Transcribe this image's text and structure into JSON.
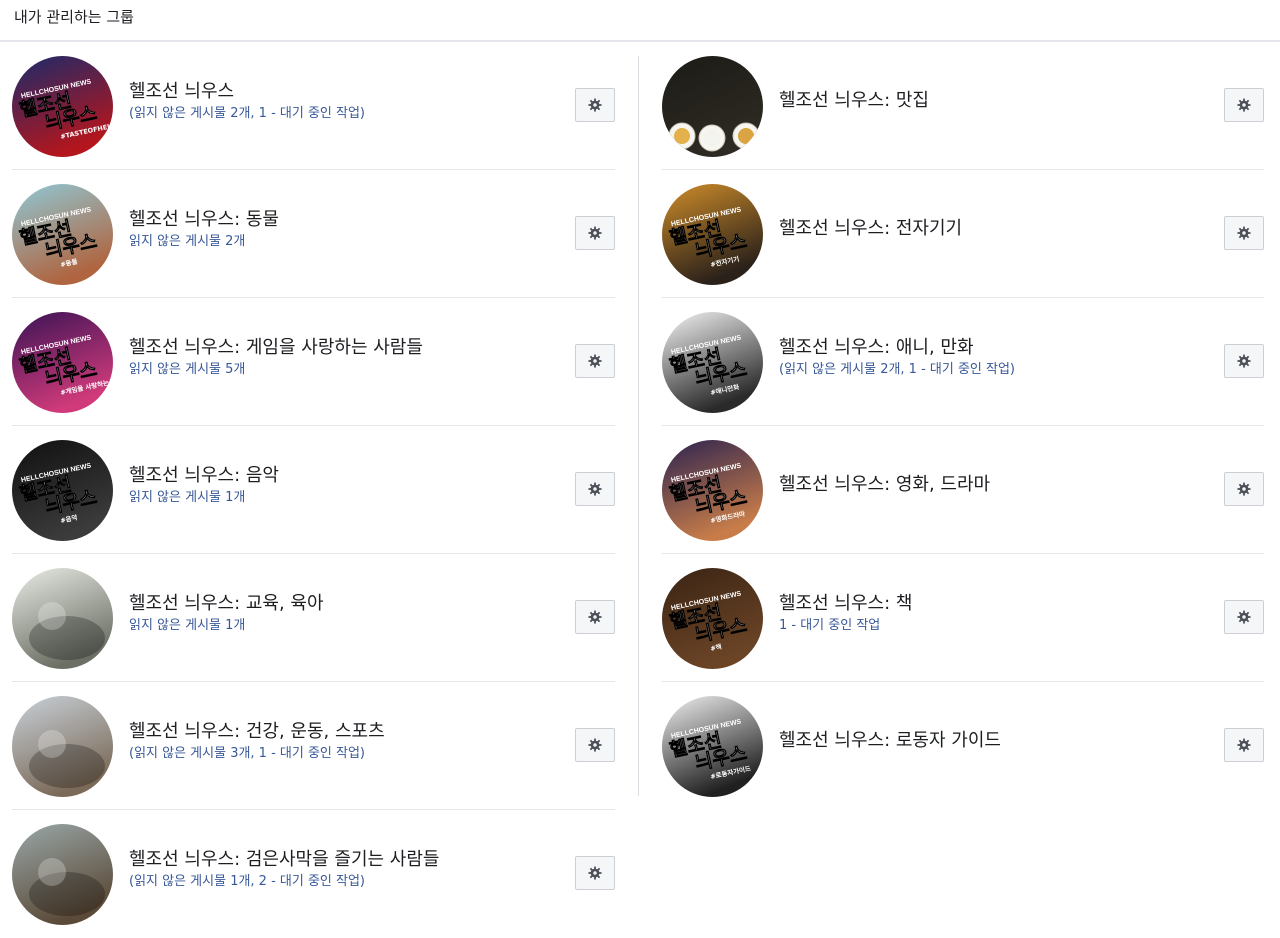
{
  "header": {
    "title": "내가 관리하는 그룹"
  },
  "left": [
    {
      "name": "헬조선 늬우스",
      "status": "(읽지 않은 게시물 2개, 1 - 대기 중인 작업)",
      "avatar": "avatar-tasteofhell"
    },
    {
      "name": "헬조선 늬우스: 동물",
      "status": "읽지 않은 게시물 2개",
      "avatar": "avatar-animals"
    },
    {
      "name": "헬조선 늬우스: 게임을 사랑하는 사람들",
      "status": "읽지 않은 게시물 5개",
      "avatar": "avatar-games"
    },
    {
      "name": "헬조선 늬우스: 음악",
      "status": "읽지 않은 게시물 1개",
      "avatar": "avatar-music"
    },
    {
      "name": "헬조선 늬우스: 교육, 육아",
      "status": "읽지 않은 게시물 1개",
      "avatar": "avatar-education"
    },
    {
      "name": "헬조선 늬우스: 건강, 운동, 스포츠",
      "status": "(읽지 않은 게시물 3개, 1 - 대기 중인 작업)",
      "avatar": "avatar-health"
    },
    {
      "name": "헬조선 늬우스: 검은사막을 즐기는 사람들",
      "status": "(읽지 않은 게시물 1개, 2 - 대기 중인 작업)",
      "avatar": "avatar-blackdesert"
    }
  ],
  "right": [
    {
      "name": "헬조선 늬우스: 맛집",
      "status": "",
      "avatar": "avatar-food"
    },
    {
      "name": "헬조선 늬우스: 전자기기",
      "status": "",
      "avatar": "avatar-electronics"
    },
    {
      "name": "헬조선 늬우스: 애니, 만화",
      "status": "(읽지 않은 게시물 2개, 1 - 대기 중인 작업)",
      "avatar": "avatar-anime"
    },
    {
      "name": "헬조선 늬우스: 영화, 드라마",
      "status": "",
      "avatar": "avatar-movies"
    },
    {
      "name": "헬조선 늬우스: 책",
      "status": "1 - 대기 중인 작업",
      "avatar": "avatar-books"
    },
    {
      "name": "헬조선 늬우스: 로동자 가이드",
      "status": "",
      "avatar": "avatar-workers"
    }
  ],
  "logo": {
    "top": "HELLCHOSUN NEWS",
    "main1": "헬조선",
    "main2": "늬우스"
  },
  "tags": {
    "tasteofhell": "#TASTEOFHELL",
    "animals": "#동물",
    "games": "#게임을 사랑하는 사람들",
    "music": "#음악",
    "electronics": "#전자기기",
    "anime": "#애니만화",
    "movies": "#영화드라마",
    "books": "#책",
    "workers": "#로동자가이드"
  },
  "colors": {
    "link": "#385898",
    "text": "#1c1e21",
    "divider": "#e4e6eb",
    "button_bg": "#f5f6f7",
    "button_border": "#ccd0d5"
  },
  "icons": {
    "settings": "gear-icon"
  }
}
